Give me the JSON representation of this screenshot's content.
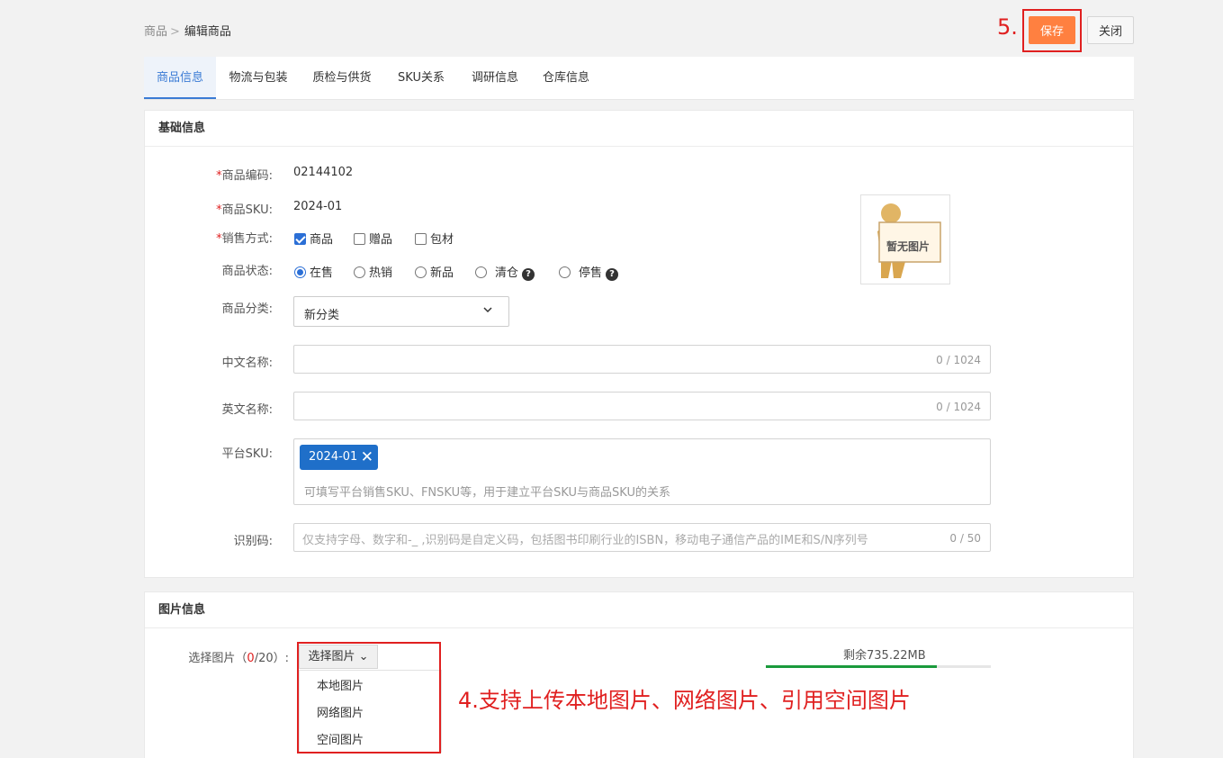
{
  "breadcrumb": {
    "parent": "商品",
    "separator": ">",
    "current": "编辑商品"
  },
  "toolbar": {
    "step_label": "5.",
    "save_label": "保存",
    "close_label": "关闭"
  },
  "tabs": [
    "商品信息",
    "物流与包装",
    "质检与供货",
    "SKU关系",
    "调研信息",
    "仓库信息"
  ],
  "basic": {
    "title": "基础信息",
    "required_mark": "*",
    "code_label": "商品编码:",
    "code_value": "02144102",
    "sku_label": "商品SKU:",
    "sku_value": "2024-01",
    "sale_label": "销售方式:",
    "sale_options": [
      {
        "label": "商品",
        "checked": true
      },
      {
        "label": "赠品",
        "checked": false
      },
      {
        "label": "包材",
        "checked": false
      }
    ],
    "status_label": "商品状态:",
    "status_options": [
      {
        "label": "在售",
        "selected": true
      },
      {
        "label": "热销",
        "selected": false
      },
      {
        "label": "新品",
        "selected": false
      },
      {
        "label": "清仓",
        "selected": false,
        "help": true
      },
      {
        "label": "停售",
        "selected": false,
        "help": true
      }
    ],
    "help_glyph": "?",
    "category_label": "商品分类:",
    "category_value": "新分类",
    "cn_name_label": "中文名称:",
    "cn_name_counter": "0 / 1024",
    "en_name_label": "英文名称:",
    "en_name_counter": "0 / 1024",
    "platform_sku_label": "平台SKU:",
    "platform_sku_tag": "2024-01",
    "platform_sku_hint": "可填写平台销售SKU、FNSKU等，用于建立平台SKU与商品SKU的关系",
    "ident_label": "识别码:",
    "ident_placeholder": "仅支持字母、数字和-_ ,识别码是自定义码，包括图书印刷行业的ISBN，移动电子通信产品的IME和S/N序列号",
    "ident_counter": "0 / 50",
    "no_image_text": "暂无图片"
  },
  "images": {
    "title": "图片信息",
    "select_label_prefix": "选择图片（",
    "select_count": "0",
    "select_label_suffix": "/20）:",
    "select_button": "选择图片",
    "menu_items": [
      "本地图片",
      "网络图片",
      "空间图片"
    ],
    "annotation": "4.支持上传本地图片、网络图片、引用空间图片",
    "quota_text": "剩余735.22MB",
    "quota_used_fraction": 0.76
  },
  "colors": {
    "accent": "#3a7bd5",
    "save": "#ff8040",
    "annotation": "#e02020",
    "tag": "#1f6fc9",
    "quota": "#1a9a3c"
  }
}
